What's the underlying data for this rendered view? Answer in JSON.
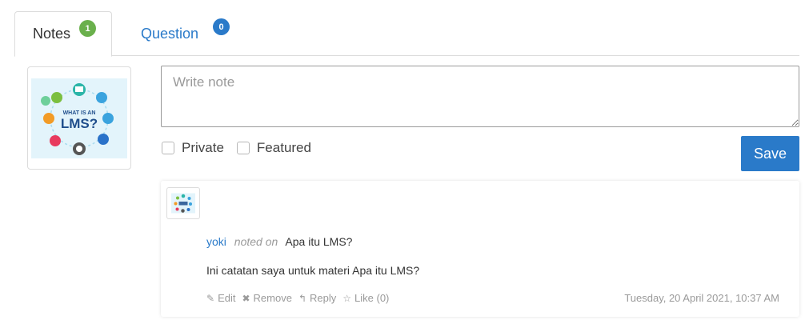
{
  "tabs": [
    {
      "label": "Notes",
      "count": "1"
    },
    {
      "label": "Question",
      "count": "0"
    }
  ],
  "lesson_thumbnail": {
    "text_line1": "WHAT IS AN",
    "text_line2": "LMS?"
  },
  "note_form": {
    "placeholder": "Write note",
    "value": "",
    "private_label": "Private",
    "featured_label": "Featured",
    "save_label": "Save"
  },
  "note": {
    "user": "yoki",
    "verb": "noted on",
    "subject": "Apa itu LMS?",
    "body": "Ini catatan saya untuk materi Apa itu LMS?",
    "actions": {
      "edit": "Edit",
      "remove": "Remove",
      "reply": "Reply",
      "like": "Like (0)"
    },
    "timestamp": "Tuesday, 20 April 2021, 10:37 AM"
  },
  "colors": {
    "accent": "#2a7ac9",
    "notes_badge": "#6ab04c",
    "muted": "#9a9a9a"
  }
}
